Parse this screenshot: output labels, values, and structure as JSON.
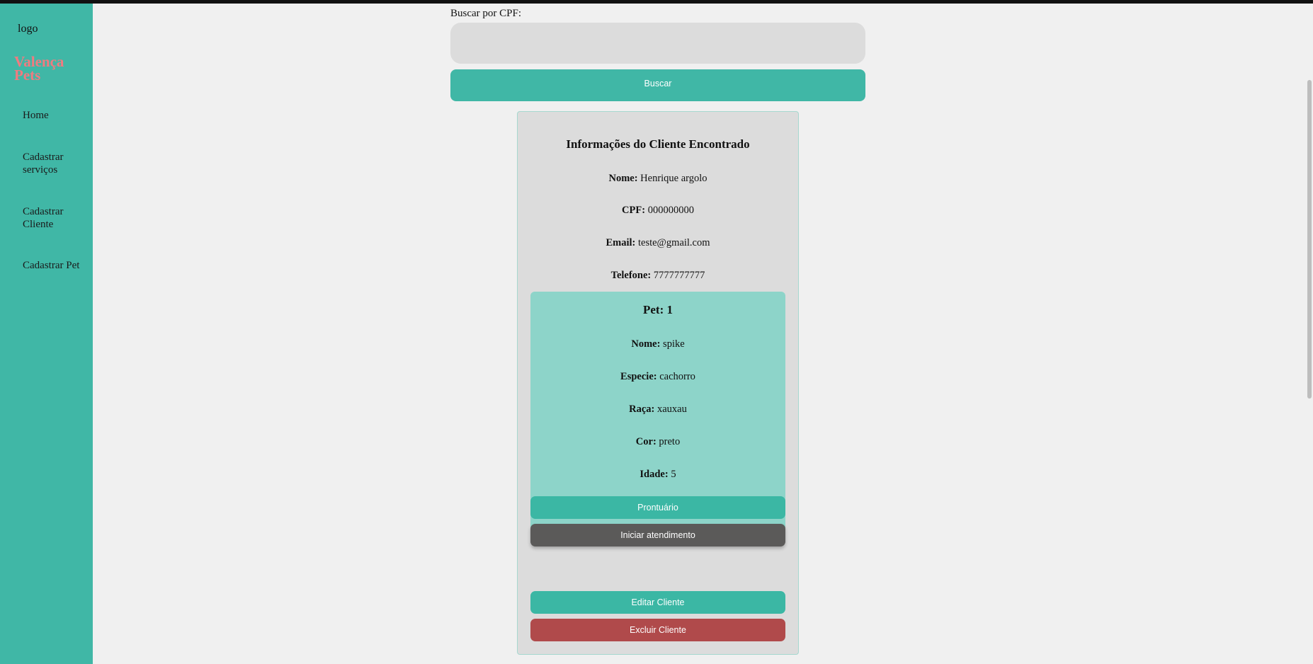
{
  "sidebar": {
    "logo_alt": "logo",
    "brand": "Valença Pets",
    "nav": [
      {
        "label": "Home"
      },
      {
        "label": "Cadastrar serviços"
      },
      {
        "label": "Cadastrar Cliente"
      },
      {
        "label": "Cadastrar Pet"
      }
    ]
  },
  "search": {
    "label": "Buscar por CPF:",
    "value": "",
    "placeholder": "",
    "button_label": "Buscar"
  },
  "client": {
    "title": "Informações do Cliente Encontrado",
    "fields": [
      {
        "label": "Nome:",
        "value": "Henrique argolo"
      },
      {
        "label": "CPF:",
        "value": "000000000"
      },
      {
        "label": "Email:",
        "value": "teste@gmail.com"
      },
      {
        "label": "Telefone:",
        "value": "7777777777"
      }
    ],
    "edit_label": "Editar Cliente",
    "delete_label": "Excluir Cliente"
  },
  "pet": {
    "title": "Pet: 1",
    "fields": [
      {
        "label": "Nome:",
        "value": "spike"
      },
      {
        "label": "Especie:",
        "value": "cachorro"
      },
      {
        "label": "Raça:",
        "value": "xauxau"
      },
      {
        "label": "Cor:",
        "value": "preto"
      },
      {
        "label": "Idade:",
        "value": "5"
      }
    ],
    "prontuario_label": "Prontuário",
    "iniciar_label": "Iniciar atendimento"
  },
  "colors": {
    "sidebar": "#40b7a6",
    "brand": "#f07b80",
    "card": "#dcdcdc",
    "pet_card": "#8dd4c9",
    "primary_button": "#3bb7a4",
    "dark_button": "#5b5a59",
    "danger_button": "#b04a4b"
  }
}
